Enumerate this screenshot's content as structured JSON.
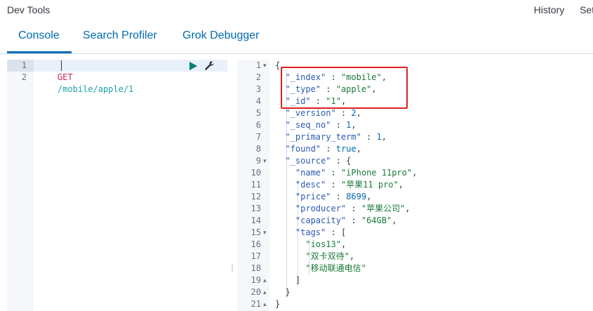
{
  "app": {
    "title": "Dev Tools"
  },
  "top_links": {
    "history": "History",
    "settings": "Sett"
  },
  "tabs": [
    {
      "label": "Console"
    },
    {
      "label": "Search Profiler"
    },
    {
      "label": "Grok Debugger"
    }
  ],
  "request": {
    "method": "GET",
    "path": "/mobile/apple/1",
    "line_numbers": [
      "1",
      "2"
    ]
  },
  "response": {
    "line_numbers": [
      "1",
      "2",
      "3",
      "4",
      "5",
      "6",
      "7",
      "8",
      "9",
      "10",
      "11",
      "12",
      "13",
      "14",
      "15",
      "16",
      "17",
      "18",
      "19",
      "20",
      "21"
    ],
    "lines": [
      "{",
      "  \"_index\" : \"mobile\",",
      "  \"_type\" : \"apple\",",
      "  \"_id\" : \"1\",",
      "  \"_version\" : 2,",
      "  \"_seq_no\" : 1,",
      "  \"_primary_term\" : 1,",
      "  \"found\" : true,",
      "  \"_source\" : {",
      "    \"name\" : \"iPhone 11pro\",",
      "    \"desc\" : \"苹果11 pro\",",
      "    \"price\" : 8699,",
      "    \"producer\" : \"苹果公司\",",
      "    \"capacity\" : \"64GB\",",
      "    \"tags\" : [",
      "      \"ios13\",",
      "      \"双卡双待\",",
      "      \"移动联通电信\"",
      "    ]",
      "  }",
      "}"
    ],
    "fold_markers": {
      "1": "▾",
      "9": "▾",
      "15": "▾",
      "19": "▴",
      "20": "▴",
      "21": "▴"
    }
  },
  "colors": {
    "accent": "#006bb4",
    "highlight_border": "#e02020"
  },
  "icons": {
    "run": "play-icon",
    "settings": "wrench-icon",
    "splitter": "drag-handle-icon"
  }
}
